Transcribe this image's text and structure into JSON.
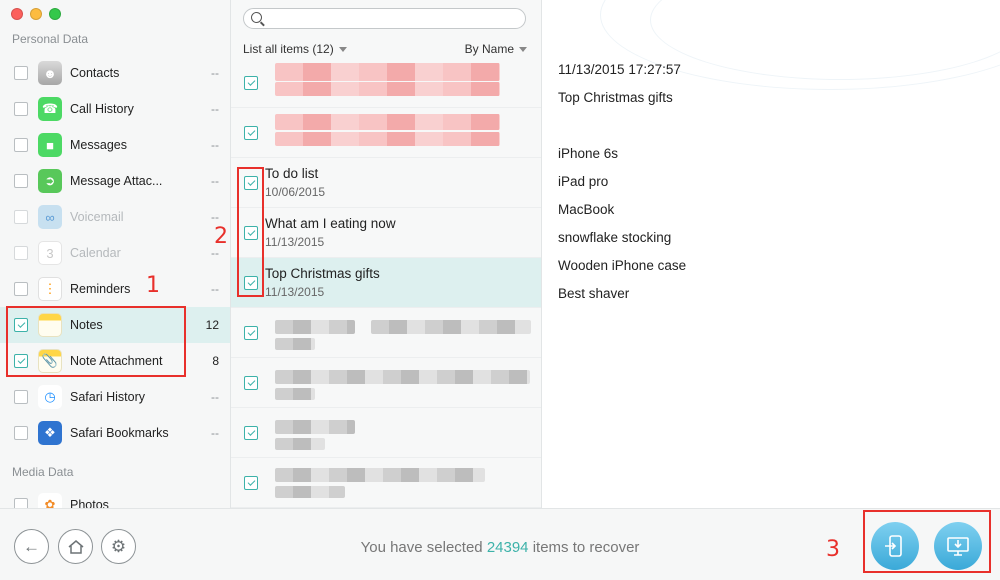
{
  "sidebar": {
    "personal_heading": "Personal Data",
    "media_heading": "Media Data",
    "items": [
      {
        "label": "Contacts",
        "count": "--",
        "checked": false,
        "disabled": false,
        "icon": "contacts-icon"
      },
      {
        "label": "Call History",
        "count": "--",
        "checked": false,
        "disabled": false,
        "icon": "phone-icon"
      },
      {
        "label": "Messages",
        "count": "--",
        "checked": false,
        "disabled": false,
        "icon": "messages-icon"
      },
      {
        "label": "Message Attac...",
        "count": "--",
        "checked": false,
        "disabled": false,
        "icon": "message-attachment-icon"
      },
      {
        "label": "Voicemail",
        "count": "--",
        "checked": false,
        "disabled": true,
        "icon": "voicemail-icon"
      },
      {
        "label": "Calendar",
        "count": "--",
        "checked": false,
        "disabled": true,
        "icon": "calendar-icon"
      },
      {
        "label": "Reminders",
        "count": "--",
        "checked": false,
        "disabled": false,
        "icon": "reminders-icon"
      },
      {
        "label": "Notes",
        "count": "12",
        "checked": true,
        "disabled": false,
        "icon": "notes-icon"
      },
      {
        "label": "Note Attachment",
        "count": "8",
        "checked": true,
        "disabled": false,
        "icon": "note-attachment-icon"
      },
      {
        "label": "Safari History",
        "count": "--",
        "checked": false,
        "disabled": false,
        "icon": "safari-history-icon"
      },
      {
        "label": "Safari Bookmarks",
        "count": "--",
        "checked": false,
        "disabled": false,
        "icon": "safari-bookmarks-icon"
      },
      {
        "label": "Photos",
        "count": "",
        "checked": false,
        "disabled": false,
        "icon": "photos-icon"
      }
    ]
  },
  "list": {
    "search_placeholder": "",
    "filter_label": "List all items (12)",
    "sort_label": "By Name",
    "notes": [
      {
        "title": "To do list",
        "date": "10/06/2015"
      },
      {
        "title": "What am I eating now",
        "date": "11/13/2015"
      },
      {
        "title": "Top Christmas gifts",
        "date": "11/13/2015"
      }
    ]
  },
  "detail": {
    "timestamp": "11/13/2015 17:27:57",
    "title": "Top Christmas gifts",
    "lines": [
      "iPhone 6s",
      "iPad pro",
      "MacBook",
      "snowflake stocking",
      "Wooden iPhone case",
      "Best shaver"
    ]
  },
  "bottom": {
    "status_prefix": "You have selected",
    "status_count": "24394",
    "status_suffix": "items to recover"
  },
  "annotations": {
    "one": "1",
    "two": "2",
    "three": "3"
  },
  "colors": {
    "accent": "#3cb2a9",
    "annotation": "#e8302b",
    "selected_row": "#ddf0ef",
    "action_button": "#3aa9d8"
  }
}
